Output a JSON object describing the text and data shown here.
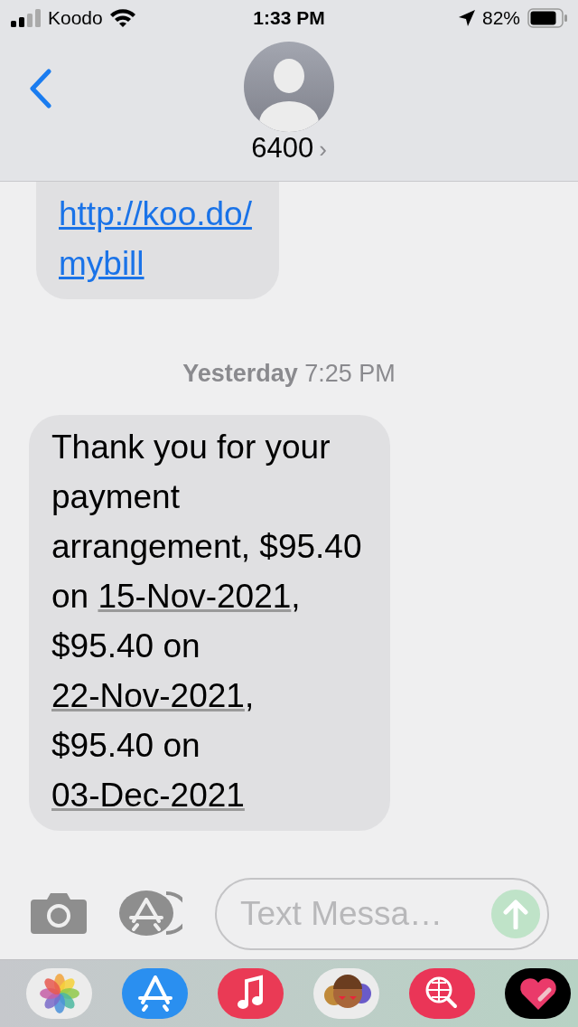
{
  "status_bar": {
    "carrier": "Koodo",
    "time": "1:33 PM",
    "battery": "82%"
  },
  "header": {
    "contact": "6400",
    "chevron": "›"
  },
  "messages": [
    {
      "kind": "bubble",
      "cut_top": true,
      "parts": [
        {
          "kind": "link",
          "text": "http://koo.do/"
        },
        {
          "kind": "link",
          "text": "mybill"
        }
      ]
    },
    {
      "kind": "timestamp",
      "day": "Yesterday",
      "time": "7:25 PM"
    },
    {
      "kind": "bubble",
      "cut_top": false,
      "parts": [
        {
          "kind": "plain",
          "text": "Thank you for your payment arrangement, $95.40 on "
        },
        {
          "kind": "date",
          "text": "15-Nov-2021"
        },
        {
          "kind": "plain",
          "text": ", $95.40 on "
        },
        {
          "kind": "date",
          "text": "22-Nov-2021"
        },
        {
          "kind": "plain",
          "text": ", $95.40 on "
        },
        {
          "kind": "date",
          "text": "03-Dec-2021"
        }
      ]
    }
  ],
  "composer": {
    "placeholder": "Text Messa…",
    "send_enabled": false
  },
  "dock": [
    {
      "kind": "photos"
    },
    {
      "kind": "appstore"
    },
    {
      "kind": "music"
    },
    {
      "kind": "stickers"
    },
    {
      "kind": "search"
    },
    {
      "kind": "heart"
    }
  ]
}
